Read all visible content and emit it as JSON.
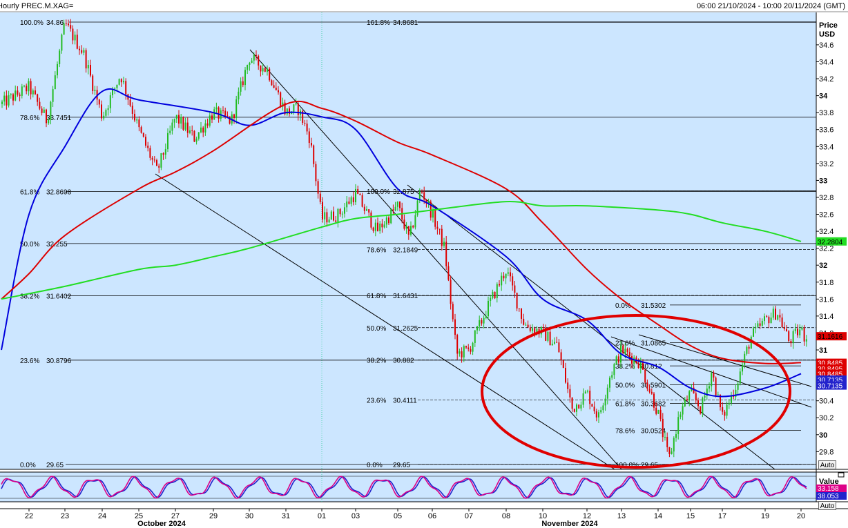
{
  "header": {
    "title": "Hourly PREC.M.XAG=",
    "range": "06:00 21/10/2024 - 10:00 20/11/2024 (GMT)"
  },
  "colors": {
    "background": "#cce6ff",
    "ma_fast": "#0000dd",
    "ma_mid": "#dd0000",
    "ma_slow": "#22dd22",
    "ellipse": "#e00000",
    "up_candle": "#22bb22",
    "down_candle": "#dd0000",
    "stoch_k": "#dd0088",
    "stoch_d": "#2222cc"
  },
  "price_axis": {
    "title": "Price",
    "unit": "USD",
    "ticks": [
      "34.6",
      "34.4",
      "34.2",
      "34",
      "33.8",
      "33.6",
      "33.4",
      "33.2",
      "33",
      "32.8",
      "32.6",
      "32.4",
      "32.2",
      "32",
      "31.8",
      "31.6",
      "31.4",
      "31.2",
      "31",
      "30.8",
      "30.6",
      "30.4",
      "30.2",
      "30",
      "29.8"
    ],
    "bold_ticks": [
      "34",
      "33",
      "32",
      "31",
      "30"
    ],
    "auto_label": "Auto"
  },
  "osc_axis": {
    "title": "Value",
    "auto_label": "Auto"
  },
  "date_axis": {
    "labels": [
      "22",
      "23",
      "24",
      "25",
      "27",
      "29",
      "30",
      "31",
      "01",
      "03",
      "05",
      "06",
      "07",
      "08",
      "10",
      "12",
      "13",
      "14",
      "15",
      "17",
      "19",
      "20"
    ],
    "months": [
      "October 2024",
      "November 2024"
    ]
  },
  "price_tags": [
    {
      "text": "32.2804",
      "bg": "#22dd22",
      "fg": "#000000",
      "price": 32.2804
    },
    {
      "text": "31.1616",
      "bg": "#dd0000",
      "fg": "#000000",
      "price": 31.1616
    },
    {
      "text": "30.8485",
      "bg": "#dd0000",
      "fg": "#ffffff",
      "price": 30.8485
    },
    {
      "text": "30.8495",
      "bg": "#dd0000",
      "fg": "#ffffff",
      "price": 30.78
    },
    {
      "text": "30.8485",
      "bg": "#dd0000",
      "fg": "#ffffff",
      "price": 30.72
    },
    {
      "text": "30.7135",
      "bg": "#2222cc",
      "fg": "#ffffff",
      "price": 30.65
    },
    {
      "text": "30.7135",
      "bg": "#2222cc",
      "fg": "#ffffff",
      "price": 30.58
    }
  ],
  "osc_tags": [
    {
      "text": "33.158",
      "bg": "#dd0088",
      "fg": "#ffffff"
    },
    {
      "text": "38.053",
      "bg": "#2222cc",
      "fg": "#ffffff"
    }
  ],
  "fib_left": [
    {
      "pct": "100.0%",
      "val": "34.86",
      "price": 34.8681
    },
    {
      "pct": "78.6%",
      "val": "33.7451",
      "price": 33.7451
    },
    {
      "pct": "61.8%",
      "val": "32.8698",
      "price": 32.8698
    },
    {
      "pct": "50.0%",
      "val": "32.255",
      "price": 32.255
    },
    {
      "pct": "38.2%",
      "val": "31.6402",
      "price": 31.6402
    },
    {
      "pct": "23.6%",
      "val": "30.8796",
      "price": 30.8796
    },
    {
      "pct": "0.0%",
      "val": "29.65",
      "price": 29.65
    }
  ],
  "fib_mid": [
    {
      "pct": "161.8%",
      "val": "34.8681",
      "price": 34.8681
    },
    {
      "pct": "100.0%",
      "val": "32.875",
      "price": 32.875
    },
    {
      "pct": "78.6%",
      "val": "32.1849",
      "price": 32.1849
    },
    {
      "pct": "61.8%",
      "val": "31.6431",
      "price": 31.6431
    },
    {
      "pct": "50.0%",
      "val": "31.2625",
      "price": 31.2625
    },
    {
      "pct": "38.2%",
      "val": "30.882",
      "price": 30.882
    },
    {
      "pct": "23.6%",
      "val": "30.4111",
      "price": 30.4111
    },
    {
      "pct": "0.0%",
      "val": "29.65",
      "price": 29.65
    }
  ],
  "fib_right": [
    {
      "pct": "0.0%",
      "val": "31.5302",
      "price": 31.5302
    },
    {
      "pct": "23.6%",
      "val": "31.0865",
      "price": 31.0865
    },
    {
      "pct": "38.2%",
      "val": "30.812",
      "price": 30.812
    },
    {
      "pct": "50.0%",
      "val": "30.5901",
      "price": 30.5901
    },
    {
      "pct": "61.8%",
      "val": "30.3682",
      "price": 30.3682
    },
    {
      "pct": "78.6%",
      "val": "30.0524",
      "price": 30.0524
    },
    {
      "pct": "100.0%",
      "val": "29.65",
      "price": 29.65
    }
  ],
  "chart_data": {
    "type": "candlestick",
    "title": "Hourly PREC.M.XAG=",
    "ylabel": "Price USD",
    "ylim": [
      29.6,
      34.95
    ],
    "x_dates": [
      "22 Oct",
      "23 Oct",
      "24 Oct",
      "25 Oct",
      "27 Oct",
      "29 Oct",
      "30 Oct",
      "31 Oct",
      "01 Nov",
      "03 Nov",
      "05 Nov",
      "06 Nov",
      "07 Nov",
      "08 Nov",
      "10 Nov",
      "12 Nov",
      "13 Nov",
      "14 Nov",
      "15 Nov",
      "17 Nov",
      "19 Nov",
      "20 Nov"
    ],
    "close_path": [
      [
        "21 Oct",
        33.9
      ],
      [
        "22 Oct",
        34.1
      ],
      [
        "22 Oct",
        33.7
      ],
      [
        "23 Oct",
        34.85
      ],
      [
        "23 Oct",
        34.5
      ],
      [
        "24 Oct",
        33.75
      ],
      [
        "24 Oct",
        34.25
      ],
      [
        "25 Oct",
        33.6
      ],
      [
        "25 Oct",
        33.1
      ],
      [
        "27 Oct",
        33.75
      ],
      [
        "27 Oct",
        33.5
      ],
      [
        "29 Oct",
        33.8
      ],
      [
        "29 Oct",
        33.7
      ],
      [
        "30 Oct",
        34.45
      ],
      [
        "30 Oct",
        34.3
      ],
      [
        "31 Oct",
        33.8
      ],
      [
        "31 Oct",
        33.85
      ],
      [
        "31 Oct",
        33.5
      ],
      [
        "01 Nov",
        32.55
      ],
      [
        "01 Nov",
        32.6
      ],
      [
        "03 Nov",
        32.85
      ],
      [
        "03 Nov",
        32.4
      ],
      [
        "05 Nov",
        32.7
      ],
      [
        "05 Nov",
        32.3
      ],
      [
        "05 Nov",
        32.9
      ],
      [
        "06 Nov",
        32.6
      ],
      [
        "06 Nov",
        32.2
      ],
      [
        "06 Nov",
        30.95
      ],
      [
        "07 Nov",
        31.0
      ],
      [
        "07 Nov",
        31.5
      ],
      [
        "08 Nov",
        31.95
      ],
      [
        "08 Nov",
        31.3
      ],
      [
        "10 Nov",
        31.2
      ],
      [
        "10 Nov",
        31.05
      ],
      [
        "10 Nov",
        30.3
      ],
      [
        "12 Nov",
        30.5
      ],
      [
        "12 Nov",
        30.2
      ],
      [
        "12 Nov",
        30.7
      ],
      [
        "13 Nov",
        31.0
      ],
      [
        "13 Nov",
        30.85
      ],
      [
        "14 Nov",
        30.25
      ],
      [
        "14 Nov",
        29.7
      ],
      [
        "14 Nov",
        30.25
      ],
      [
        "15 Nov",
        30.5
      ],
      [
        "15 Nov",
        30.3
      ],
      [
        "15 Nov",
        30.75
      ],
      [
        "17 Nov",
        30.2
      ],
      [
        "17 Nov",
        30.6
      ],
      [
        "17 Nov",
        31.15
      ],
      [
        "19 Nov",
        31.35
      ],
      [
        "19 Nov",
        31.45
      ],
      [
        "19 Nov",
        31.1
      ],
      [
        "20 Nov",
        31.25
      ],
      [
        "20 Nov",
        31.16
      ]
    ],
    "series": [
      {
        "kind": "moving-average",
        "path": [
          [
            "21 Oct",
            31.0
          ],
          [
            "22 Oct",
            32.6
          ],
          [
            "23 Oct",
            33.4
          ],
          [
            "24 Oct",
            34.05
          ],
          [
            "25 Oct",
            33.95
          ],
          [
            "29 Oct",
            33.8
          ],
          [
            "30 Oct",
            33.65
          ],
          [
            "31 Oct",
            33.8
          ],
          [
            "01 Nov",
            33.75
          ],
          [
            "03 Nov",
            33.6
          ],
          [
            "05 Nov",
            32.9
          ],
          [
            "06 Nov",
            32.7
          ],
          [
            "08 Nov",
            32.1
          ],
          [
            "10 Nov",
            31.6
          ],
          [
            "12 Nov",
            31.35
          ],
          [
            "13 Nov",
            30.95
          ],
          [
            "14 Nov",
            30.8
          ],
          [
            "15 Nov",
            30.55
          ],
          [
            "17 Nov",
            30.45
          ],
          [
            "19 Nov",
            30.55
          ],
          [
            "20 Nov",
            30.72
          ]
        ]
      },
      {
        "kind": "moving-average",
        "path": [
          [
            "21 Oct",
            31.6
          ],
          [
            "22 Oct",
            31.9
          ],
          [
            "23 Oct",
            32.35
          ],
          [
            "25 Oct",
            32.9
          ],
          [
            "27 Oct",
            33.1
          ],
          [
            "29 Oct",
            33.35
          ],
          [
            "31 Oct",
            33.9
          ],
          [
            "01 Nov",
            33.85
          ],
          [
            "03 Nov",
            33.7
          ],
          [
            "05 Nov",
            33.45
          ],
          [
            "06 Nov",
            33.3
          ],
          [
            "08 Nov",
            32.9
          ],
          [
            "10 Nov",
            32.5
          ],
          [
            "12 Nov",
            31.95
          ],
          [
            "13 Nov",
            31.6
          ],
          [
            "14 Nov",
            31.3
          ],
          [
            "15 Nov",
            31.05
          ],
          [
            "17 Nov",
            30.9
          ],
          [
            "19 Nov",
            30.84
          ],
          [
            "20 Nov",
            30.85
          ]
        ]
      },
      {
        "kind": "moving-average",
        "path": [
          [
            "21 Oct",
            31.6
          ],
          [
            "23 Oct",
            31.75
          ],
          [
            "25 Oct",
            31.95
          ],
          [
            "27 Oct",
            32.0
          ],
          [
            "29 Oct",
            32.1
          ],
          [
            "30 Oct",
            32.2
          ],
          [
            "01 Nov",
            32.45
          ],
          [
            "03 Nov",
            32.55
          ],
          [
            "05 Nov",
            32.6
          ],
          [
            "06 Nov",
            32.65
          ],
          [
            "08 Nov",
            32.75
          ],
          [
            "10 Nov",
            32.7
          ],
          [
            "12 Nov",
            32.7
          ],
          [
            "14 Nov",
            32.65
          ],
          [
            "15 Nov",
            32.6
          ],
          [
            "17 Nov",
            32.5
          ],
          [
            "19 Nov",
            32.4
          ],
          [
            "20 Nov",
            32.28
          ]
        ]
      }
    ],
    "oscillator": {
      "name": "Stochastic",
      "values": [
        33.158,
        38.053
      ],
      "range": [
        0,
        100
      ]
    }
  }
}
